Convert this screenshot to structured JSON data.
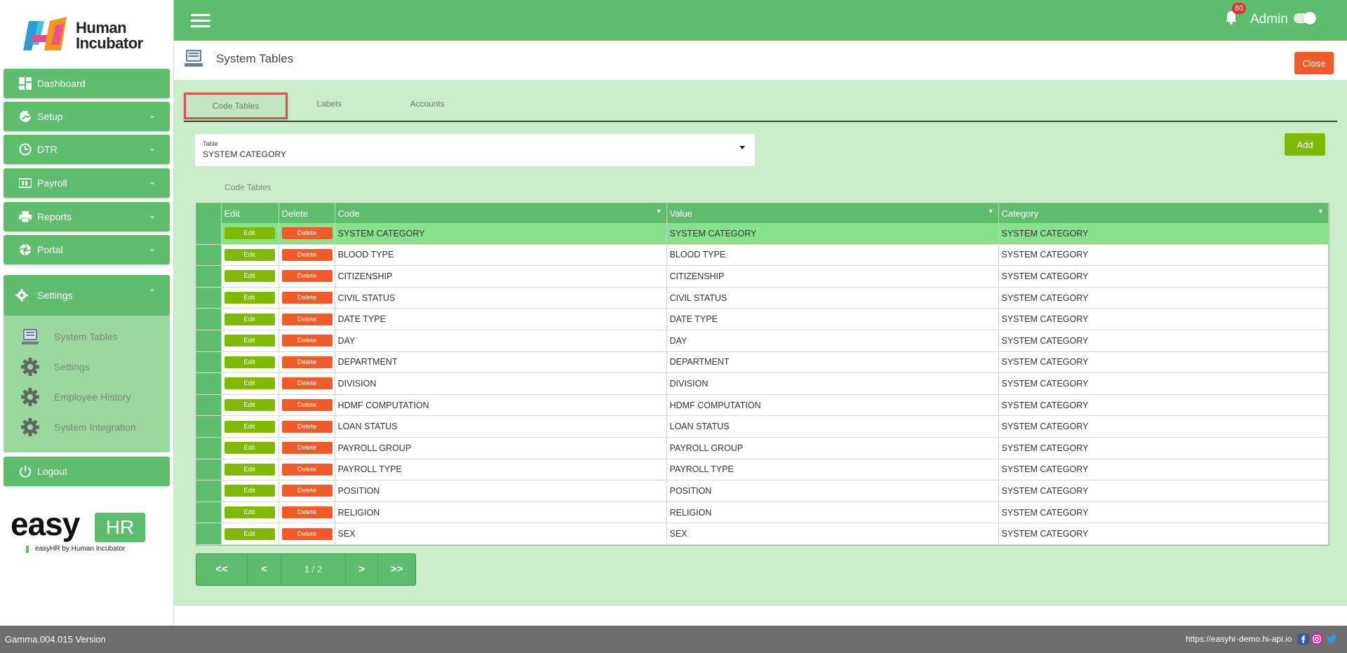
{
  "brand": {
    "logo_line1": "Human",
    "logo_line2": "Incubator",
    "footer_logo_word": "easy",
    "footer_logo_badge": "HR",
    "footer_tagline": "easyHR by Human Incubator"
  },
  "sidebar": {
    "items": [
      {
        "label": "Dashboard",
        "icon": "dashboard-icon"
      },
      {
        "label": "Setup",
        "icon": "wrench-icon"
      },
      {
        "label": "DTR",
        "icon": "clock-icon"
      },
      {
        "label": "Payroll",
        "icon": "payroll-icon"
      },
      {
        "label": "Reports",
        "icon": "printer-icon"
      },
      {
        "label": "Portal",
        "icon": "aperture-icon"
      }
    ],
    "settings_label": "Settings",
    "settings_sub": [
      {
        "label": "System Tables",
        "icon": "computer-icon"
      },
      {
        "label": "Settings",
        "icon": "gear-icon"
      },
      {
        "label": "Employee History",
        "icon": "gear-icon"
      },
      {
        "label": "System Integration",
        "icon": "gear-icon"
      }
    ],
    "logout_label": "Logout"
  },
  "header": {
    "notification_count": "80",
    "user_label": "Admin"
  },
  "titlebar": {
    "title": "System Tables",
    "close_label": "Close"
  },
  "tabs": [
    {
      "label": "Code Tables",
      "active": true
    },
    {
      "label": "Labels",
      "active": false
    },
    {
      "label": "Accounts",
      "active": false
    }
  ],
  "table_select": {
    "caption": "Table",
    "value": "SYSTEM CATEGORY"
  },
  "add_label": "Add",
  "grid": {
    "caption": "Code Tables",
    "columns": [
      "Edit",
      "Delete",
      "Code",
      "Value",
      "Category"
    ],
    "edit_label": "Edit",
    "delete_label": "Delete",
    "rows": [
      [
        "SYSTEM CATEGORY",
        "SYSTEM CATEGORY",
        "SYSTEM CATEGORY"
      ],
      [
        "BLOOD TYPE",
        "BLOOD TYPE",
        "SYSTEM CATEGORY"
      ],
      [
        "CITIZENSHIP",
        "CITIZENSHIP",
        "SYSTEM CATEGORY"
      ],
      [
        "CIVIL STATUS",
        "CIVIL STATUS",
        "SYSTEM CATEGORY"
      ],
      [
        "DATE TYPE",
        "DATE TYPE",
        "SYSTEM CATEGORY"
      ],
      [
        "DAY",
        "DAY",
        "SYSTEM CATEGORY"
      ],
      [
        "DEPARTMENT",
        "DEPARTMENT",
        "SYSTEM CATEGORY"
      ],
      [
        "DIVISION",
        "DIVISION",
        "SYSTEM CATEGORY"
      ],
      [
        "HDMF COMPUTATION",
        "HDMF COMPUTATION",
        "SYSTEM CATEGORY"
      ],
      [
        "LOAN STATUS",
        "LOAN STATUS",
        "SYSTEM CATEGORY"
      ],
      [
        "PAYROLL GROUP",
        "PAYROLL GROUP",
        "SYSTEM CATEGORY"
      ],
      [
        "PAYROLL TYPE",
        "PAYROLL TYPE",
        "SYSTEM CATEGORY"
      ],
      [
        "POSITION",
        "POSITION",
        "SYSTEM CATEGORY"
      ],
      [
        "RELIGION",
        "RELIGION",
        "SYSTEM CATEGORY"
      ],
      [
        "SEX",
        "SEX",
        "SYSTEM CATEGORY"
      ]
    ]
  },
  "pager": {
    "first": "<<",
    "prev": "<",
    "page_label": "1 / 2",
    "next": ">",
    "last": ">>"
  },
  "footer": {
    "version": "Gamma.004.015 Version",
    "url": "https://easyhr-demo.hi-api.io"
  },
  "colors": {
    "primary_green": "#5fbd6e",
    "content_bg": "#ccedc9",
    "highlight_row": "#88e28b",
    "edit_green": "#7fba00",
    "delete_orange": "#f15a29",
    "footer_gray": "#6e6e6e"
  }
}
